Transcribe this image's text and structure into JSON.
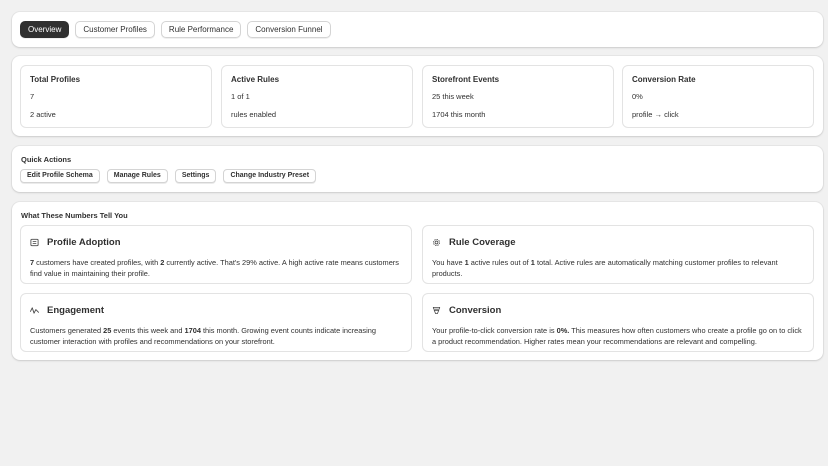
{
  "tabs": [
    {
      "label": "Overview",
      "active": true
    },
    {
      "label": "Customer Profiles",
      "active": false
    },
    {
      "label": "Rule Performance",
      "active": false
    },
    {
      "label": "Conversion Funnel",
      "active": false
    }
  ],
  "stats": [
    {
      "title": "Total Profiles",
      "value": "7",
      "sub": "2 active"
    },
    {
      "title": "Active Rules",
      "value": "1 of 1",
      "sub": "rules enabled"
    },
    {
      "title": "Storefront Events",
      "value": "25 this week",
      "sub": "1704 this month"
    },
    {
      "title": "Conversion Rate",
      "value": "0%",
      "sub": "profile → click"
    }
  ],
  "quick_actions": {
    "title": "Quick Actions",
    "buttons": [
      "Edit Profile Schema",
      "Manage Rules",
      "Settings",
      "Change Industry Preset"
    ]
  },
  "insights": {
    "title": "What These Numbers Tell You",
    "items": [
      {
        "icon": "profile-list-icon",
        "name": "Profile Adoption",
        "parts": [
          {
            "b": "7"
          },
          {
            "t": " customers have created profiles, with "
          },
          {
            "b": "2"
          },
          {
            "t": " currently active. That's 29% active. A high active rate means customers find value in maintaining their profile."
          }
        ]
      },
      {
        "icon": "gear-icon",
        "name": "Rule Coverage",
        "parts": [
          {
            "t": "You have "
          },
          {
            "b": "1"
          },
          {
            "t": " active rules out of "
          },
          {
            "b": "1"
          },
          {
            "t": " total. Active rules are automatically matching customer profiles to relevant products."
          }
        ]
      },
      {
        "icon": "activity-icon",
        "name": "Engagement",
        "parts": [
          {
            "t": "Customers generated "
          },
          {
            "b": "25"
          },
          {
            "t": " events this week and "
          },
          {
            "b": "1704"
          },
          {
            "t": " this month. Growing event counts indicate increasing customer interaction with profiles and recommendations on your storefront."
          }
        ]
      },
      {
        "icon": "funnel-icon",
        "name": "Conversion",
        "parts": [
          {
            "t": "Your profile-to-click conversion rate is "
          },
          {
            "b": "0%."
          },
          {
            "t": " This measures how often customers who create a profile go on to click a product recommendation. Higher rates mean your recommendations are relevant and compelling."
          }
        ]
      }
    ]
  }
}
